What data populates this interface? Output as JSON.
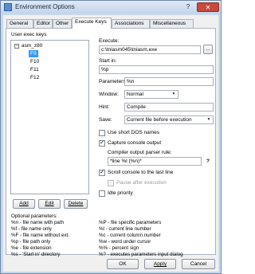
{
  "window": {
    "title": "Environment Options",
    "help": "?",
    "close": "✕"
  },
  "tabs": [
    "General",
    "Editor",
    "Other",
    "Execute Keys",
    "Associations",
    "Miscellaneous"
  ],
  "tree": {
    "label": "User exec keys",
    "root": "asm_z80",
    "items": [
      "F9",
      "F10",
      "F11",
      "F12"
    ]
  },
  "buttons": {
    "add": "Add",
    "edit": "Edit",
    "delete": "Delete",
    "browse": "...",
    "ok": "OK",
    "apply": "Apply",
    "cancel": "Cancel"
  },
  "form": {
    "execute_label": "Execute:",
    "execute_value": "c:\\tniasm045\\tniasm.exe",
    "start_in_label": "Start in:",
    "start_in_value": "%p",
    "parameters_label": "Parameters:",
    "parameters_value": "%n",
    "window_label": "Window:",
    "window_value": "Normal",
    "hint_label": "Hint:",
    "hint_value": "Compile",
    "save_label": "Save:",
    "save_value": "Current file before execution",
    "short_dos_label": "Use short DOS names",
    "capture_label": "Capture console output",
    "parser_label": "Compiler output parser rule:",
    "parser_value": "*line %l (%n)*",
    "parser_help": "?",
    "scroll_label": "Scroll console to the last line",
    "pause_label": "Pause after execution",
    "idle_label": "Idle priority"
  },
  "optional": {
    "title": "Optional parameters:",
    "left": [
      "%n  - file name with path",
      "%f  - file name only",
      "%F  - file name without ext.",
      "%p  - file path only",
      "%e  - file extension",
      "%s  - 'Start in' directory"
    ],
    "right": [
      "%P  - file specific parameters",
      "%l  - current line number",
      "%c  - current column number",
      "%w  - word under cursor",
      "%%  - percent sign",
      "%?  - executes parameters input dialog"
    ]
  }
}
